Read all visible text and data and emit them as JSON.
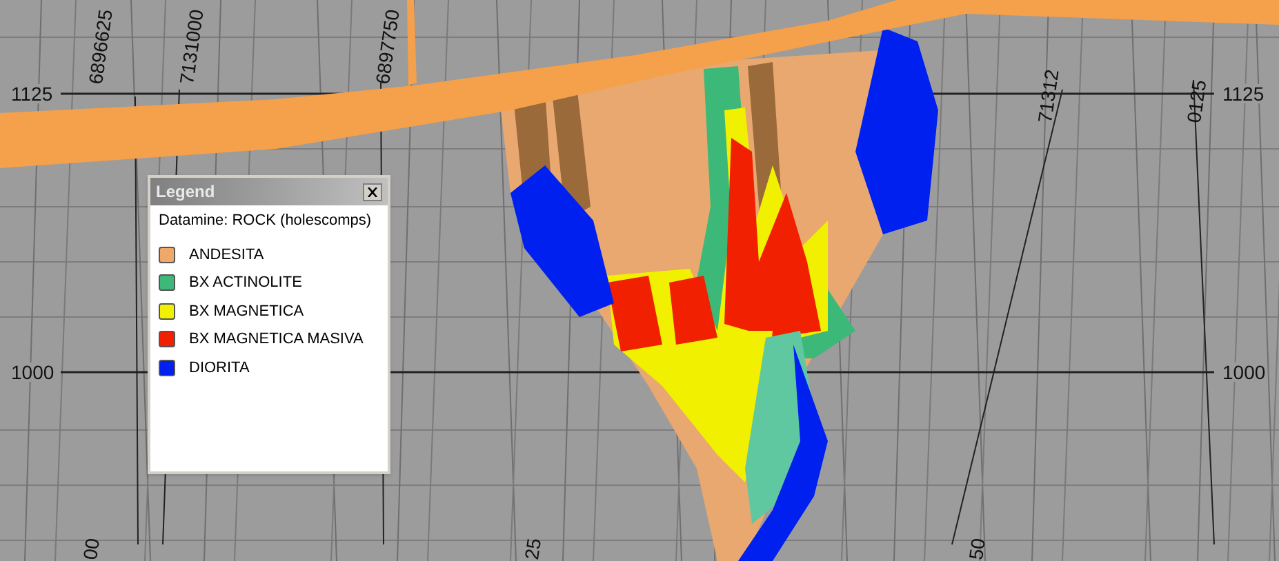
{
  "axis_labels": {
    "top": [
      {
        "text": "6896625"
      },
      {
        "text": "7131000"
      },
      {
        "text": "6897750"
      },
      {
        "text": "71312"
      },
      {
        "text": "0125"
      }
    ],
    "elevation_left": [
      {
        "text": "1125"
      },
      {
        "text": "1000"
      }
    ],
    "elevation_right": [
      {
        "text": "1125"
      },
      {
        "text": "1000"
      }
    ],
    "bottom": [
      {
        "text": "00"
      },
      {
        "text": "25"
      },
      {
        "text": "50"
      }
    ]
  },
  "legend": {
    "title": "Legend",
    "subtitle": "Datamine: ROCK (holescomps)",
    "items": [
      {
        "name": "ANDESITA",
        "color": "#f0a868"
      },
      {
        "name": "BX ACTINOLITE",
        "color": "#3cb878"
      },
      {
        "name": "BX MAGNETICA",
        "color": "#f0f000"
      },
      {
        "name": "BX MAGNETICA MASIVA",
        "color": "#f02000"
      },
      {
        "name": "DIORITA",
        "color": "#0020f0"
      }
    ]
  }
}
